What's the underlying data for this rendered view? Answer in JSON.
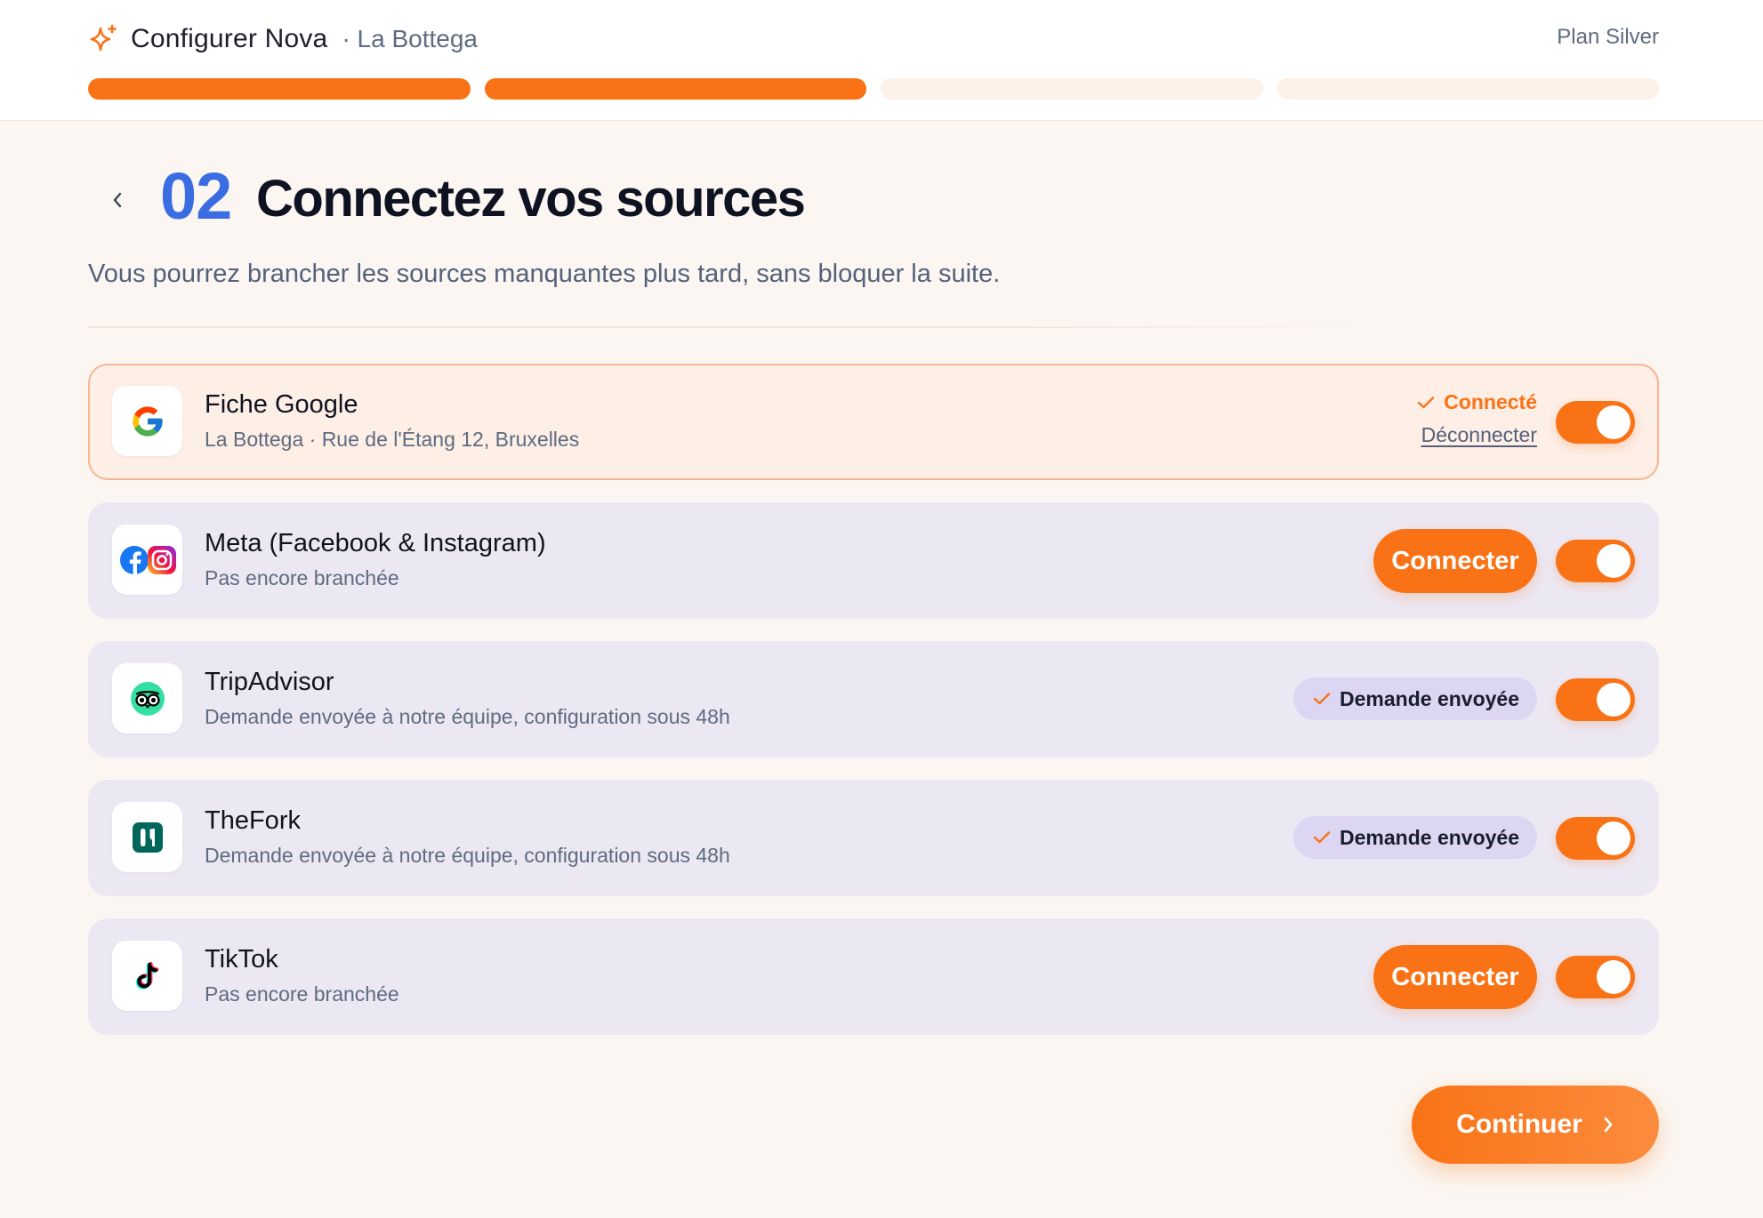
{
  "header": {
    "app_title": "Configurer Nova",
    "business": "· La Bottega",
    "plan": "Plan Silver",
    "progress": {
      "total_steps": 4,
      "completed_steps": 2
    }
  },
  "step": {
    "number": "02",
    "title": "Connectez vos sources",
    "subtitle": "Vous pourrez brancher les sources manquantes plus tard, sans bloquer la suite."
  },
  "sources": [
    {
      "name": "Fiche Google",
      "description": "La Bottega · Rue de l'Étang 12, Bruxelles",
      "icon": "google-icon",
      "state": "connected",
      "status_label": "Connecté",
      "action_label": "Déconnecter",
      "enabled": true
    },
    {
      "name": "Meta (Facebook & Instagram)",
      "description": "Pas encore branchée",
      "icon": "meta-icon",
      "state": "not_connected",
      "action_label": "Connecter",
      "enabled": true
    },
    {
      "name": "TripAdvisor",
      "description": "Demande envoyée à notre équipe, configuration sous 48h",
      "icon": "tripadvisor-icon",
      "state": "pending",
      "status_label": "Demande envoyée",
      "enabled": true
    },
    {
      "name": "TheFork",
      "description": "Demande envoyée à notre équipe, configuration sous 48h",
      "icon": "thefork-icon",
      "state": "pending",
      "status_label": "Demande envoyée",
      "enabled": true
    },
    {
      "name": "TikTok",
      "description": "Pas encore branchée",
      "icon": "tiktok-icon",
      "state": "not_connected",
      "action_label": "Connecter",
      "enabled": true
    }
  ],
  "footer": {
    "continue_label": "Continuer"
  },
  "colors": {
    "accent": "#f97316",
    "step_number": "#3b6de2",
    "card_bg": "#ece8f3",
    "active_card_bg": "#fdeee6",
    "pending_badge_bg": "#dcd6f2"
  }
}
